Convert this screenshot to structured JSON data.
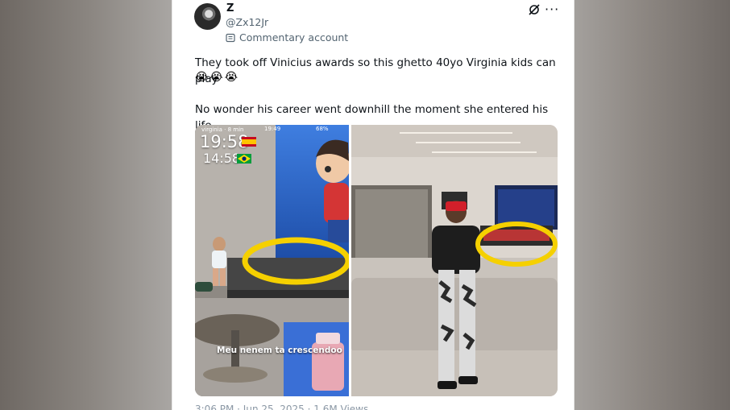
{
  "tweet": {
    "display_name": "Z",
    "handle": "@Zx12Jr",
    "badge_label": "Commentary account",
    "text_line_1": "They took off Vinicius awards so this ghetto 40yo Virginia kids can play",
    "emojis": [
      "😭",
      "😭",
      "😭"
    ],
    "text_line_2": "No wonder his career went downhill the moment she entered his life",
    "footer": "3:06 PM · Jun 25, 2025 · 1.6M Views"
  },
  "media_left": {
    "status_name": "virginia",
    "status_ago": "8 min",
    "status_clock": "19:49",
    "status_battery": "68%",
    "time_1": "19:58",
    "time_2": "14:58",
    "caption": "Meu nenem ta crescendoo"
  },
  "colors": {
    "highlight_circle": "#f5d000",
    "text_primary": "#0f1419",
    "text_secondary": "#536471"
  },
  "icons": {
    "grok": "grok-icon",
    "more": "more-icon",
    "badge": "commentary-badge-icon"
  }
}
